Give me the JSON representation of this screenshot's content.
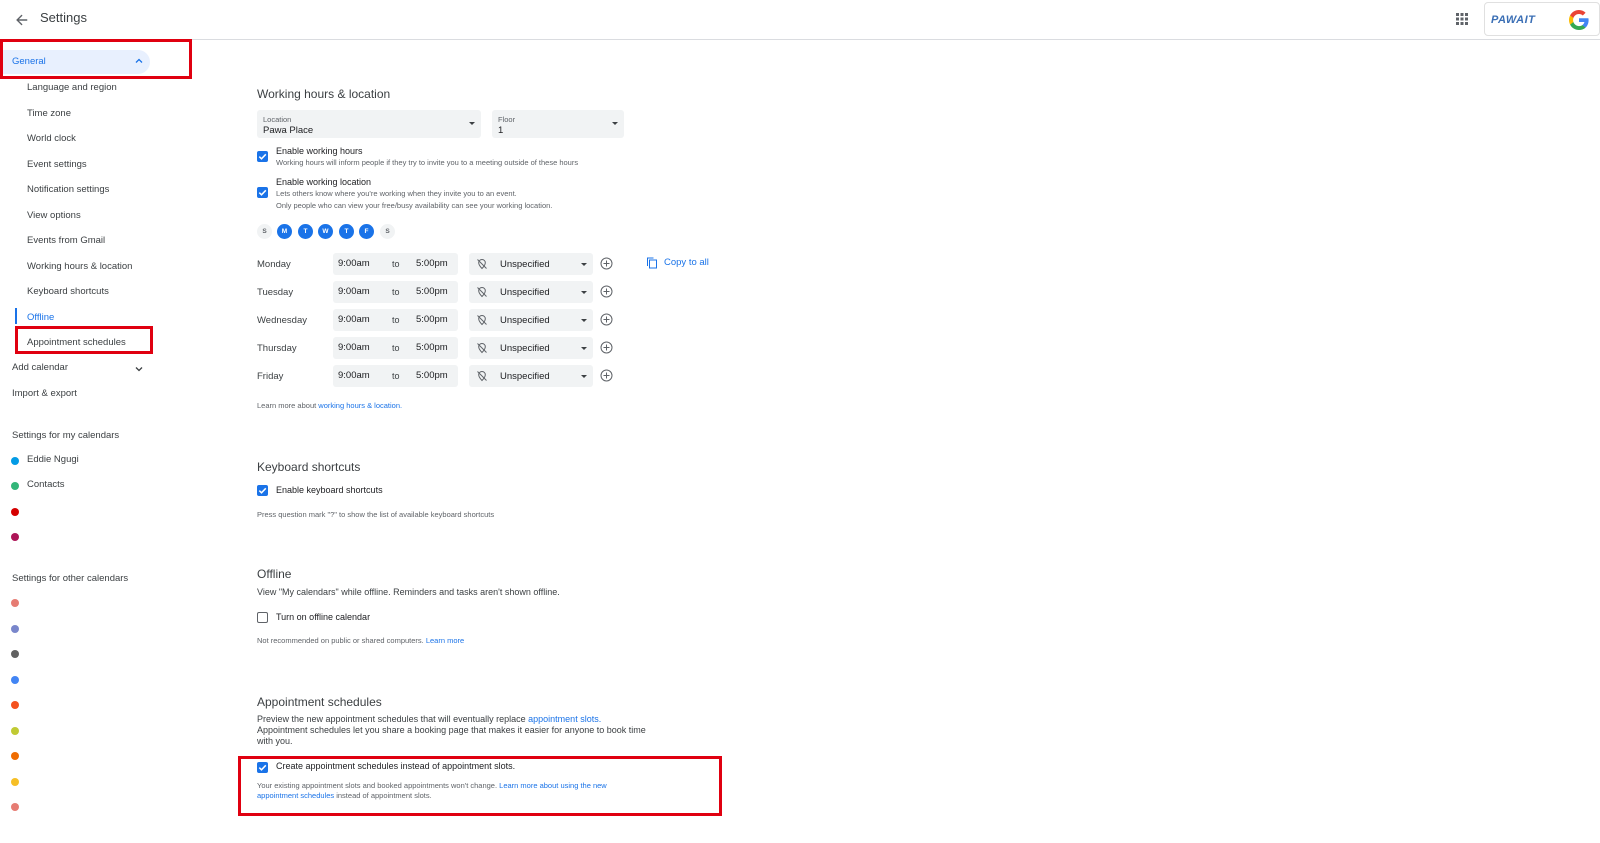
{
  "header": {
    "title": "Settings",
    "brand_text": "PAWAIT",
    "brand_g": "G"
  },
  "sidebar": {
    "general": "General",
    "sub_items": [
      {
        "label": "Language and region"
      },
      {
        "label": "Time zone"
      },
      {
        "label": "World clock"
      },
      {
        "label": "Event settings"
      },
      {
        "label": "Notification settings"
      },
      {
        "label": "View options"
      },
      {
        "label": "Events from Gmail"
      },
      {
        "label": "Working hours & location"
      },
      {
        "label": "Keyboard shortcuts"
      },
      {
        "label": "Offline"
      },
      {
        "label": "Appointment schedules"
      }
    ],
    "add_calendar": "Add calendar",
    "import_export": "Import & export",
    "my_calendars_heading": "Settings for my calendars",
    "my_calendars": [
      {
        "name": "Eddie Ngugi",
        "color": "#039be5"
      },
      {
        "name": "Contacts",
        "color": "#33b679"
      },
      {
        "name": "",
        "color": "#d50000"
      },
      {
        "name": "",
        "color": "#ad1457"
      }
    ],
    "other_calendars_heading": "Settings for other calendars",
    "other_calendars": [
      {
        "color": "#e67c73"
      },
      {
        "color": "#7986cb"
      },
      {
        "color": "#616161"
      },
      {
        "color": "#4285f4"
      },
      {
        "color": "#f4511e"
      },
      {
        "color": "#c0ca33"
      },
      {
        "color": "#ef6c00"
      },
      {
        "color": "#f6bf26"
      },
      {
        "color": "#e67c73"
      }
    ]
  },
  "working_hours": {
    "heading": "Working hours & location",
    "location_label": "Location",
    "location_value": "Pawa Place",
    "floor_label": "Floor",
    "floor_value": "1",
    "enable_hours_label": "Enable working hours",
    "enable_hours_sub": "Working hours will inform people if they try to invite you to a meeting outside of these hours",
    "enable_location_label": "Enable working location",
    "enable_location_sub1": "Lets others know where you're working when they invite you to an event.",
    "enable_location_sub2": "Only people who can view your free/busy availability can see your working location.",
    "days": [
      {
        "letter": "S",
        "on": false
      },
      {
        "letter": "M",
        "on": true
      },
      {
        "letter": "T",
        "on": true
      },
      {
        "letter": "W",
        "on": true
      },
      {
        "letter": "T",
        "on": true
      },
      {
        "letter": "F",
        "on": true
      },
      {
        "letter": "S",
        "on": false
      }
    ],
    "to_label": "to",
    "rows": [
      {
        "day": "Monday",
        "start": "9:00am",
        "end": "5:00pm",
        "location": "Unspecified"
      },
      {
        "day": "Tuesday",
        "start": "9:00am",
        "end": "5:00pm",
        "location": "Unspecified"
      },
      {
        "day": "Wednesday",
        "start": "9:00am",
        "end": "5:00pm",
        "location": "Unspecified"
      },
      {
        "day": "Thursday",
        "start": "9:00am",
        "end": "5:00pm",
        "location": "Unspecified"
      },
      {
        "day": "Friday",
        "start": "9:00am",
        "end": "5:00pm",
        "location": "Unspecified"
      }
    ],
    "copy_to_all": "Copy to all",
    "learn_more_prefix": "Learn more about ",
    "learn_more_link": "working hours & location."
  },
  "keyboard": {
    "heading": "Keyboard shortcuts",
    "enable_label": "Enable keyboard shortcuts",
    "hint": "Press question mark \"?\" to show the list of available keyboard shortcuts"
  },
  "offline": {
    "heading": "Offline",
    "description": "View \"My calendars\" while offline. Reminders and tasks aren't shown offline.",
    "toggle_label": "Turn on offline calendar",
    "note_prefix": "Not recommended on public or shared computers. ",
    "note_link": "Learn more"
  },
  "appointments": {
    "heading": "Appointment schedules",
    "line1_prefix": "Preview the new appointment schedules that will eventually replace ",
    "line1_link": "appointment slots.",
    "line2": "Appointment schedules let you share a booking page that makes it easier for anyone to book time",
    "line3": "with you.",
    "create_label": "Create appointment schedules instead of appointment slots.",
    "note_prefix": "Your existing appointment slots and booked appointments won't change. ",
    "note_link1": "Learn more about using the new",
    "note_link2": "appointment schedules",
    "note_suffix": " instead of appointment slots."
  },
  "colors": {
    "accent": "#1a73e8",
    "highlight_frame": "#e00010"
  }
}
